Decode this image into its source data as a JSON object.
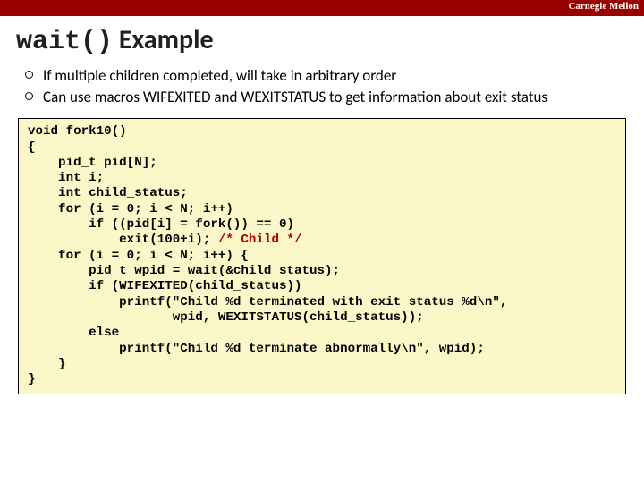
{
  "header": {
    "org": "Carnegie Mellon"
  },
  "title": {
    "mono": "wait()",
    "rest": " Example"
  },
  "bullets": [
    "If multiple children completed, will take in arbitrary order",
    "Can use macros WIFEXITED and WEXITSTATUS to get information about exit status"
  ],
  "code": {
    "l1": "void fork10()",
    "l2": "{",
    "l3": "    pid_t pid[N];",
    "l4": "    int i;",
    "l5": "    int child_status;",
    "l6": "    for (i = 0; i < N; i++)",
    "l7": "        if ((pid[i] = fork()) == 0)",
    "l8a": "            exit(100+i); ",
    "l8b": "/* Child */",
    "l9": "    for (i = 0; i < N; i++) {",
    "l10": "        pid_t wpid = wait(&child_status);",
    "l11": "        if (WIFEXITED(child_status))",
    "l12": "            printf(\"Child %d terminated with exit status %d\\n\",",
    "l13": "                   wpid, WEXITSTATUS(child_status));",
    "l14": "        else",
    "l15": "            printf(\"Child %d terminate abnormally\\n\", wpid);",
    "l16": "    }",
    "l17": "}"
  }
}
